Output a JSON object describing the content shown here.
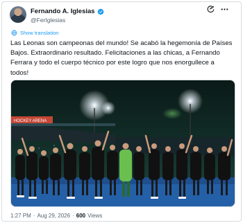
{
  "tweet": {
    "author": {
      "display_name": "Fernando A. Iglesias",
      "handle": "@FerIglesias"
    },
    "translate_label": "Show translation",
    "text": "Las Leonas son campeonas del mundo! Se acabó la hegemonía de Países Bajos. Extraordinario resultado. Felicitaciones a las chicas, a Fernando Ferrara y todo el cuerpo técnico por este logro que nos enorgullece a todos!",
    "time": "1:27 PM",
    "separator_1": "·",
    "date": "Aug 29, 2026",
    "separator_2": "·",
    "views_count": "600",
    "views_label": "Views"
  },
  "media": {
    "description_icon": "photo",
    "banner_text": "HOCKEY ARENA"
  },
  "colors": {
    "accent": "#1d9bf0",
    "secondary_text": "#536471",
    "primary_text": "#0f1419",
    "jersey": "#111111"
  },
  "icons": {
    "verified": "verified-badge-icon",
    "grok": "grok-icon",
    "more": "more-icon",
    "translate": "globe-icon"
  }
}
